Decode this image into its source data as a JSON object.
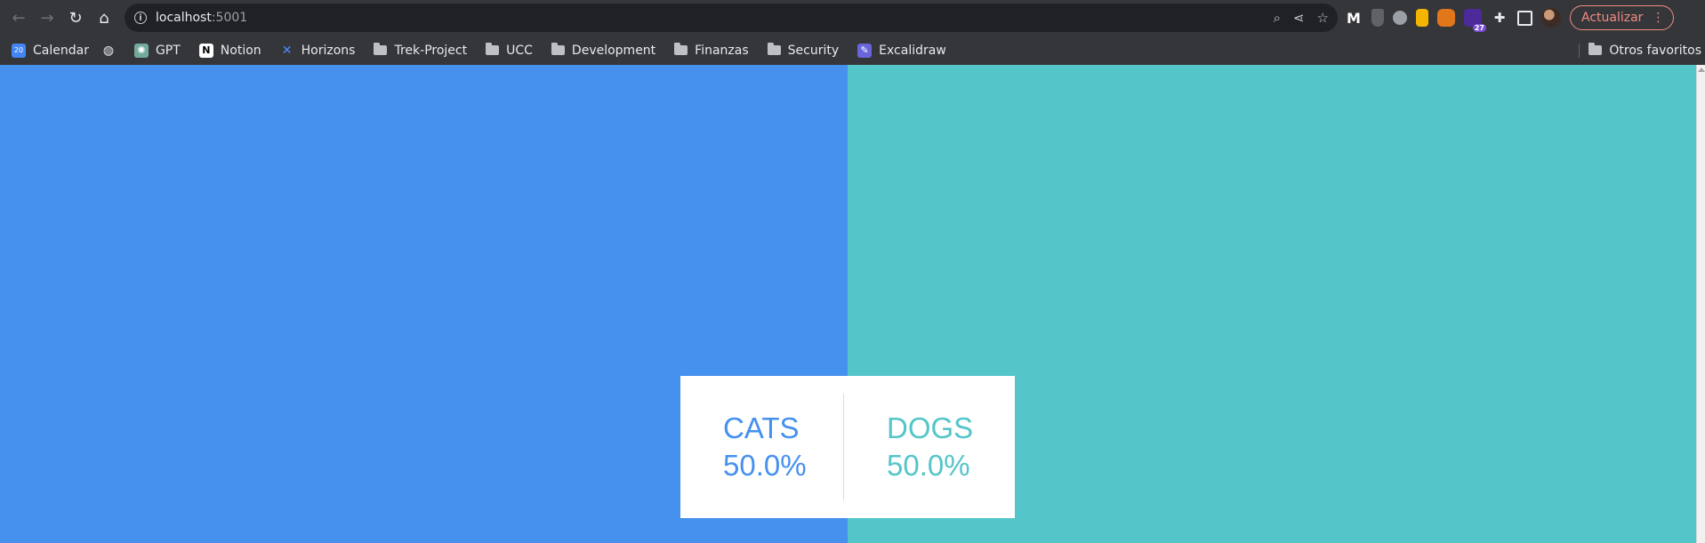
{
  "browser": {
    "url_host": "localhost",
    "url_port": ":5001",
    "update_label": "Actualizar",
    "extension_badge": "27"
  },
  "bookmarks": [
    {
      "label": "Calendar",
      "icon": "calendar-icon"
    },
    {
      "label": "",
      "icon": "globe-icon"
    },
    {
      "label": "GPT",
      "icon": "openai-icon"
    },
    {
      "label": "Notion",
      "icon": "notion-icon"
    },
    {
      "label": "Horizons",
      "icon": "horizons-icon"
    },
    {
      "label": "Trek-Project",
      "icon": "folder-icon"
    },
    {
      "label": "UCC",
      "icon": "folder-icon"
    },
    {
      "label": "Development",
      "icon": "folder-icon"
    },
    {
      "label": "Finanzas",
      "icon": "folder-icon"
    },
    {
      "label": "Security",
      "icon": "folder-icon"
    },
    {
      "label": "Excalidraw",
      "icon": "excalidraw-icon"
    }
  ],
  "other_bookmarks_label": "Otros favoritos",
  "vote": {
    "cats_label": "CATS",
    "cats_percent": "50.0%",
    "dogs_label": "DOGS",
    "dogs_percent": "50.0%",
    "cats_color": "#4690ee",
    "dogs_color": "#54c5c9"
  }
}
